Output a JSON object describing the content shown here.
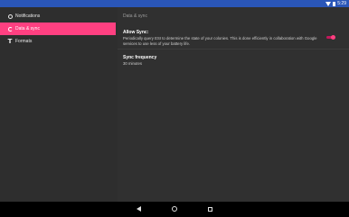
{
  "status_bar": {
    "time": "5:29"
  },
  "sidebar": {
    "items": [
      {
        "label": "Notifications",
        "icon": "bell-icon",
        "active": false
      },
      {
        "label": "Data & sync",
        "icon": "sync-icon",
        "active": true
      },
      {
        "label": "Formats",
        "icon": "format-icon",
        "active": false
      }
    ]
  },
  "detail": {
    "section_header": "Data & sync",
    "allow_sync": {
      "title": "Allow Sync:",
      "summary": "Periodically query ESI to determine the state of your colonies. This is done efficiently in collaboration with Google services to use less of your battery life.",
      "enabled": true
    },
    "sync_frequency": {
      "title": "Sync frequency",
      "value": "30 minutes"
    }
  },
  "colors": {
    "accent": "#ff4081",
    "status_bar": "#2a56b8",
    "background": "#303030"
  }
}
